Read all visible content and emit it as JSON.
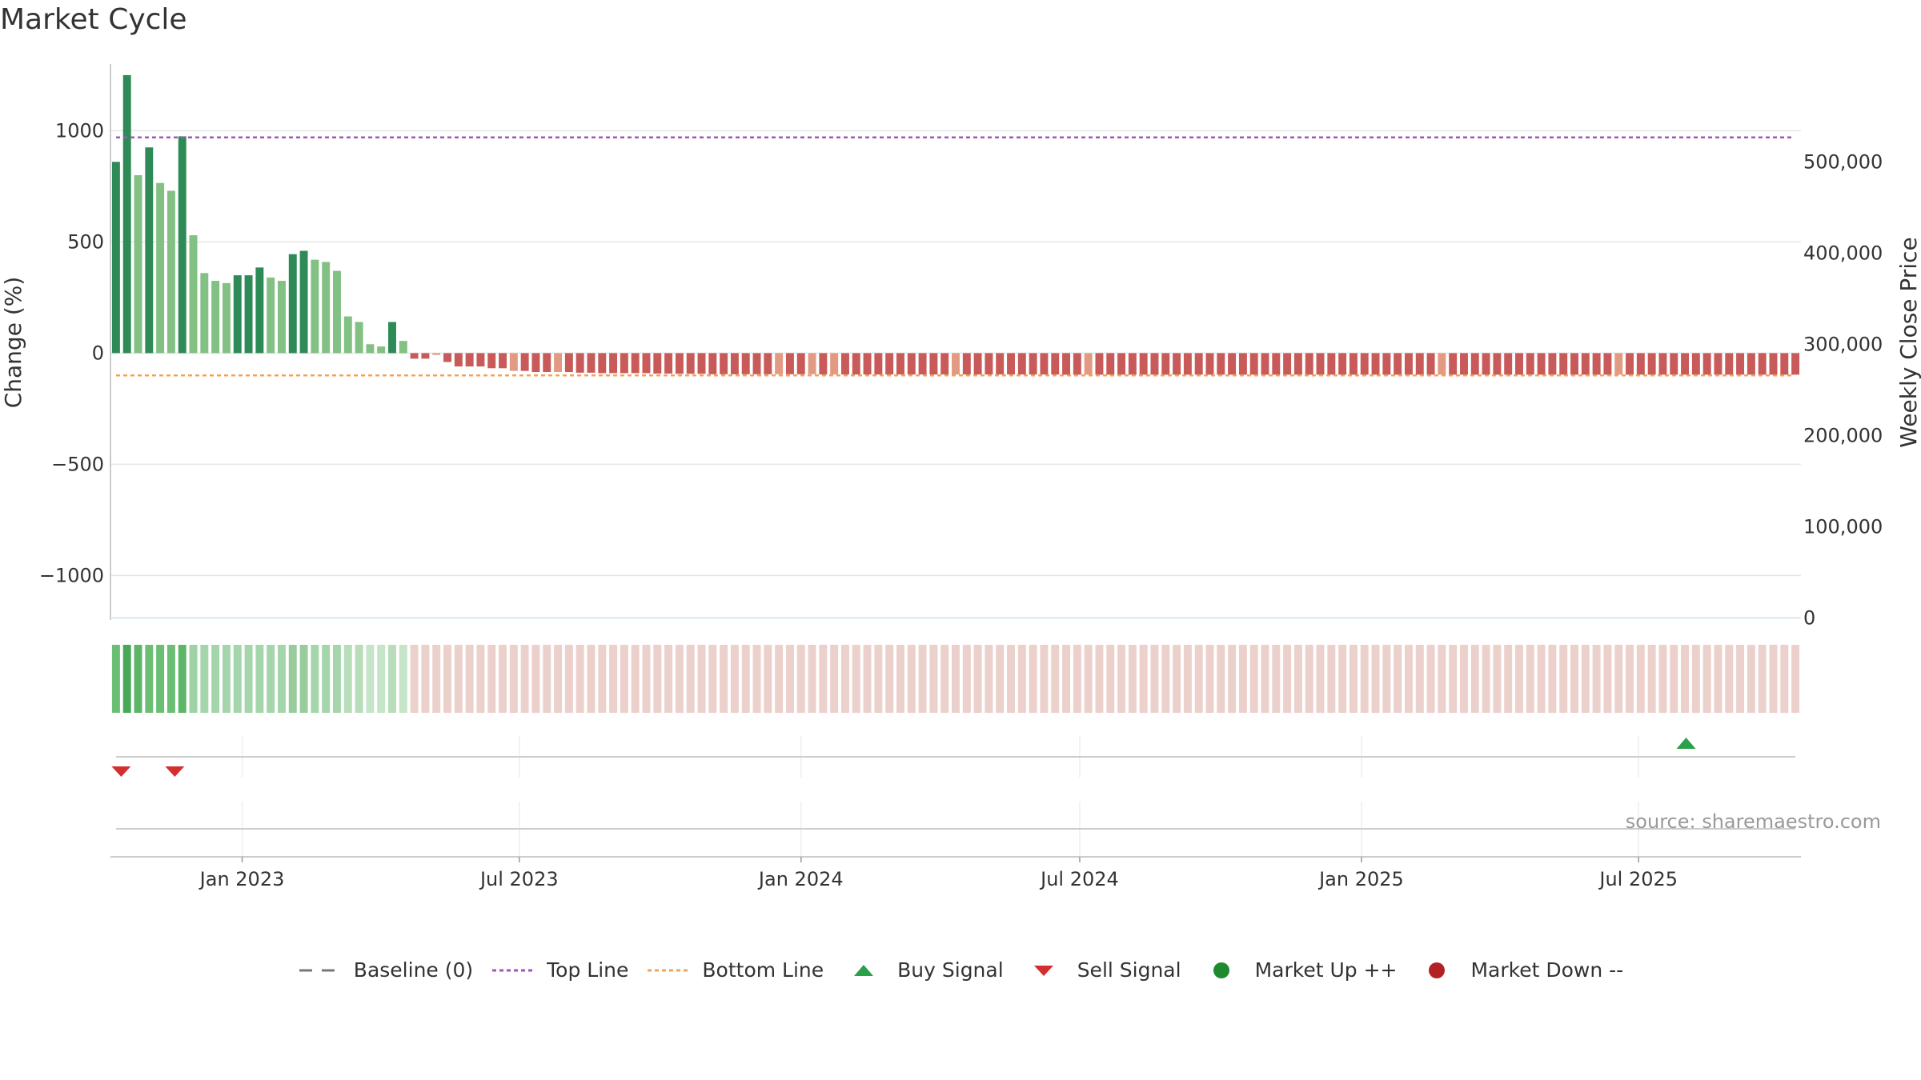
{
  "title": "Market Cycle",
  "source": "source: sharemaestro.com",
  "chart_data": {
    "type": "bar",
    "title": "Market Cycle",
    "xlabel": "",
    "ylabel": "Change (%)",
    "y2label": "Weekly Close Price",
    "ylim": [
      -1200,
      1300
    ],
    "y2lim": [
      0,
      500000
    ],
    "yticks": [
      -1000,
      -500,
      0,
      500,
      1000
    ],
    "yticklabels": [
      "−1000",
      "−500",
      "0",
      "500",
      "1000"
    ],
    "y2ticks": [
      0,
      100000,
      200000,
      300000,
      400000,
      500000
    ],
    "y2ticklabels": [
      "0",
      "100,000",
      "200,000",
      "300,000",
      "400,000",
      "500,000"
    ],
    "xlim": [
      "2022-10-07",
      "2025-10-15"
    ],
    "xticks": [
      "2023-01-01",
      "2023-07-01",
      "2024-01-01",
      "2024-07-01",
      "2025-01-01",
      "2025-07-01"
    ],
    "xticklabels": [
      "Jan 2023",
      "Jul 2023",
      "Jan 2024",
      "Jul 2024",
      "Jan 2025",
      "Jul 2025"
    ],
    "start_date": "2022-10-07",
    "frequency": "weekly",
    "top_line": 970,
    "bottom_line": -100,
    "baseline": 0,
    "grid": true,
    "colors": {
      "strong_up": "#2e8b57",
      "up": "#82c084",
      "down": "#c85a5a",
      "weak_down": "#e39a82",
      "top_line": "#9b59b6",
      "bottom_line": "#f0a35e",
      "buy": "#2aa04a",
      "sell": "#d32f2f",
      "market_up": "#1e8a2e",
      "market_down": "#b22222",
      "baseline": "#777777"
    },
    "bar_values": [
      860,
      1250,
      800,
      925,
      765,
      730,
      975,
      530,
      360,
      325,
      315,
      350,
      350,
      385,
      340,
      325,
      445,
      460,
      420,
      410,
      370,
      165,
      140,
      40,
      30,
      140,
      55,
      -25,
      -25,
      -8,
      -40,
      -60,
      -60,
      -60,
      -68,
      -68,
      -80,
      -80,
      -85,
      -85,
      -85,
      -85,
      -88,
      -88,
      -90,
      -90,
      -90,
      -90,
      -90,
      -92,
      -92,
      -93,
      -93,
      -93,
      -95,
      -95,
      -95,
      -95,
      -95,
      -95,
      -95,
      -95,
      -95,
      -95,
      -96,
      -96,
      -96,
      -96,
      -96,
      -96,
      -96,
      -96,
      -96,
      -96,
      -96,
      -96,
      -96,
      -96,
      -96,
      -96,
      -96,
      -96,
      -96,
      -96,
      -96,
      -96,
      -97,
      -97,
      -97,
      -97,
      -97,
      -97,
      -97,
      -97,
      -97,
      -97,
      -97,
      -97,
      -97,
      -97,
      -97,
      -97,
      -97,
      -97,
      -97,
      -97,
      -97,
      -97,
      -97,
      -97,
      -97,
      -97,
      -97,
      -97,
      -97,
      -97,
      -97,
      -97,
      -97,
      -97,
      -97,
      -97,
      -97,
      -97,
      -97,
      -97,
      -97,
      -97,
      -97,
      -97,
      -97,
      -97,
      -97,
      -97,
      -97,
      -97,
      -97,
      -97,
      -97,
      -97,
      -97,
      -97,
      -97,
      -97,
      -97,
      -97,
      -97,
      -97,
      -97,
      -97,
      -97,
      -97,
      -97
    ],
    "bar_colors": [
      "strong_up",
      "strong_up",
      "up",
      "strong_up",
      "up",
      "up",
      "strong_up",
      "up",
      "up",
      "up",
      "up",
      "strong_up",
      "strong_up",
      "strong_up",
      "up",
      "up",
      "strong_up",
      "strong_up",
      "up",
      "up",
      "up",
      "up",
      "up",
      "up",
      "up",
      "strong_up",
      "up",
      "down",
      "down",
      "weak_down",
      "down",
      "down",
      "down",
      "down",
      "down",
      "down",
      "weak_down",
      "down",
      "down",
      "down",
      "weak_down",
      "down",
      "down",
      "down",
      "down",
      "down",
      "down",
      "down",
      "down",
      "down",
      "down",
      "down",
      "down",
      "down",
      "down",
      "down",
      "down",
      "down",
      "down",
      "down",
      "weak_down",
      "down",
      "down",
      "weak_down",
      "down",
      "weak_down",
      "down",
      "down",
      "down",
      "down",
      "down",
      "down",
      "down",
      "down",
      "down",
      "down",
      "weak_down",
      "down",
      "down",
      "down",
      "down",
      "down",
      "down",
      "down",
      "down",
      "down",
      "down",
      "down",
      "weak_down",
      "down",
      "down",
      "down",
      "down",
      "down",
      "down",
      "down",
      "down",
      "down",
      "down",
      "down",
      "down",
      "down",
      "down",
      "down",
      "down",
      "down",
      "down",
      "down",
      "down",
      "down",
      "down",
      "down",
      "down",
      "down",
      "down",
      "down",
      "down",
      "down",
      "down",
      "down",
      "weak_down",
      "down",
      "down",
      "down",
      "down",
      "down",
      "down",
      "down",
      "down",
      "down",
      "down",
      "down",
      "down",
      "down",
      "down",
      "down",
      "weak_down",
      "down",
      "down",
      "down",
      "down",
      "down",
      "down",
      "down",
      "down",
      "down",
      "down",
      "down",
      "down",
      "down",
      "down",
      "down",
      "down",
      "down",
      "down",
      "down",
      "down",
      "down",
      "down"
    ],
    "strip_colors": [
      "#6bbf74",
      "#47a957",
      "#5db567",
      "#6bbf74",
      "#6bbf74",
      "#6bbf74",
      "#5db567",
      "#9fd2a4",
      "#a5d5aa",
      "#a5d5aa",
      "#a5d5aa",
      "#a5d5aa",
      "#a5d5aa",
      "#a5d5aa",
      "#a5d5aa",
      "#a5d5aa",
      "#98cc9d",
      "#98cc9d",
      "#a5d5aa",
      "#a5d5aa",
      "#a5d5aa",
      "#b7ddba",
      "#b7ddba",
      "#c5e4c8",
      "#c5e4c8",
      "#b7ddba",
      "#c5e4c8"
    ],
    "strip_down_color": "#ecd0cc",
    "signals": {
      "buy": [
        "2025-08-01"
      ],
      "sell": [
        "2022-10-14",
        "2022-11-18"
      ]
    },
    "legend": [
      {
        "label": "Baseline (0)",
        "symbol": "dash",
        "color": "#777777"
      },
      {
        "label": "Top Line",
        "symbol": "dotted",
        "color": "#9b59b6"
      },
      {
        "label": "Bottom Line",
        "symbol": "dotted",
        "color": "#f0a35e"
      },
      {
        "label": "Buy Signal",
        "symbol": "triangle-up",
        "color": "#2aa04a"
      },
      {
        "label": "Sell Signal",
        "symbol": "triangle-down",
        "color": "#d32f2f"
      },
      {
        "label": "Market Up ++",
        "symbol": "circle",
        "color": "#1e8a2e"
      },
      {
        "label": "Market Down --",
        "symbol": "circle",
        "color": "#b22222"
      }
    ]
  }
}
